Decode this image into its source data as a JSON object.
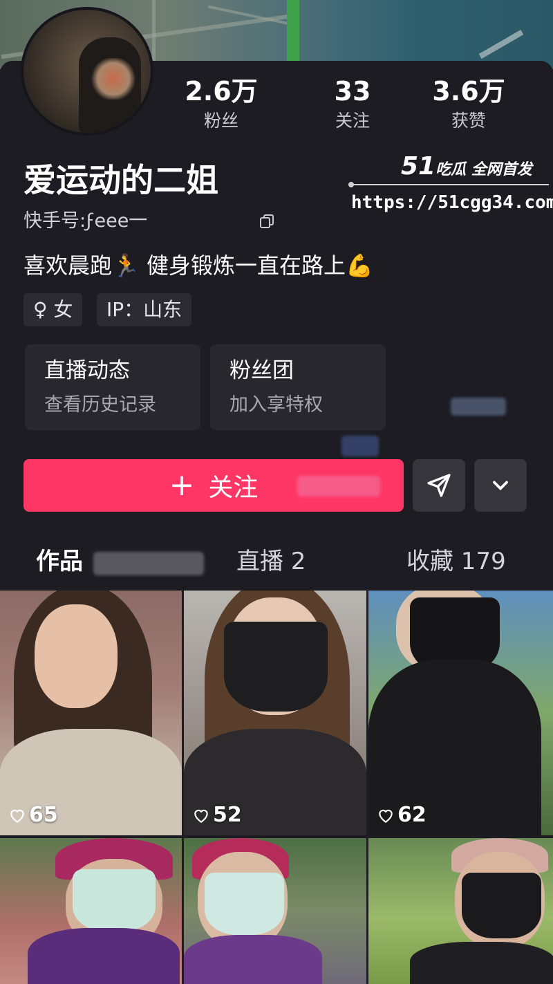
{
  "profile": {
    "username": "爱运动的二姐",
    "kuaishou_id": "快手号:ϝ𝖾𝖾𝖾一",
    "bio": "喜欢晨跑🏃 健身锻炼一直在路上💪",
    "tags": [
      "♀ 女",
      "IP：山东"
    ]
  },
  "stats": [
    {
      "value": "2.6万",
      "label": "粉丝"
    },
    {
      "value": "33",
      "label": "关注"
    },
    {
      "value": "3.6万",
      "label": "获赞"
    }
  ],
  "features": [
    {
      "title": "直播动态",
      "subtitle": "查看历史记录"
    },
    {
      "title": "粉丝团",
      "subtitle": "加入享特权"
    }
  ],
  "actions": {
    "follow_plus": "+",
    "follow_label": "关注"
  },
  "tabs": [
    {
      "label": "作品"
    },
    {
      "label": "直播 2"
    },
    {
      "label": "收藏 179"
    }
  ],
  "watermark": {
    "brand_num": "51",
    "brand_text": "吃瓜 全网首发",
    "url": "https://51cgg34.com"
  },
  "videos": [
    {
      "likes": "65"
    },
    {
      "likes": "52"
    },
    {
      "likes": "62"
    },
    {
      "likes": ""
    },
    {
      "likes": ""
    },
    {
      "likes": ""
    }
  ],
  "colors": {
    "background": "#1d1c23",
    "follow_button": "#fe3666",
    "card": "#28272e"
  }
}
